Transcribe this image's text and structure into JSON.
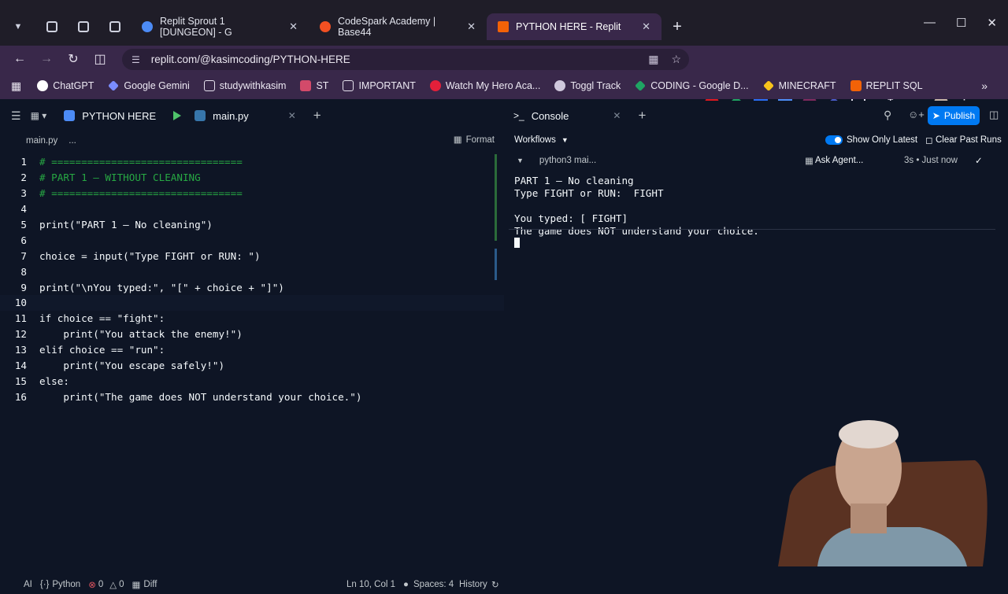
{
  "browser": {
    "tabs": [
      {
        "title": "Replit Sprout 1 [DUNGEON] - G",
        "favicon_color": "#4c8bf5"
      },
      {
        "title": "CodeSpark Academy | Base44",
        "favicon_color": "#f25022"
      },
      {
        "title": "PYTHON HERE - Replit",
        "favicon_color": "#f26207"
      }
    ],
    "url": "replit.com/@kasimcoding/PYTHON-HERE",
    "bookmarks": [
      "ChatGPT",
      "Google Gemini",
      "studywithkasim",
      "ST",
      "IMPORTANT",
      "Watch My Hero Aca...",
      "Toggl Track",
      "CODING - Google D...",
      "MINECRAFT",
      "REPLIT SQL"
    ]
  },
  "editor": {
    "project_name": "PYTHON HERE",
    "file_tab": "main.py",
    "breadcrumb_file": "main.py",
    "breadcrumb_more": "...",
    "format_label": "Format",
    "code_lines": [
      "# ================================",
      "# PART 1 — WITHOUT CLEANING",
      "# ================================",
      "",
      "print(\"PART 1 — No cleaning\")",
      "",
      "choice = input(\"Type FIGHT or RUN: \")",
      "",
      "print(\"\\nYou typed:\", \"[\" + choice + \"]\")",
      "",
      "if choice == \"fight\":",
      "    print(\"You attack the enemy!\")",
      "elif choice == \"run\":",
      "    print(\"You escape safely!\")",
      "else:",
      "    print(\"The game does NOT understand your choice.\")"
    ],
    "line_numbers": [
      "1",
      "2",
      "3",
      "4",
      "5",
      "6",
      "7",
      "8",
      "9",
      "10",
      "11",
      "12",
      "13",
      "14",
      "15",
      "16"
    ],
    "status": {
      "ai": "AI",
      "language": "Python",
      "errors": "0",
      "warnings": "0",
      "diff": "Diff",
      "position": "Ln 10, Col 1",
      "spaces": "Spaces: 4",
      "history": "History"
    }
  },
  "console": {
    "tab_label": "Console",
    "workflows_label": "Workflows",
    "show_only_latest": "Show Only Latest",
    "clear_past_runs": "Clear Past Runs",
    "run_name": "python3 mai...",
    "ask_agent": "Ask Agent...",
    "run_time": "3s • Just now",
    "publish_label": "Publish",
    "output_lines": [
      "PART 1 — No cleaning",
      "Type FIGHT or RUN:  FIGHT",
      "",
      "You typed: [ FIGHT]",
      "The game does NOT understand your choice."
    ]
  }
}
